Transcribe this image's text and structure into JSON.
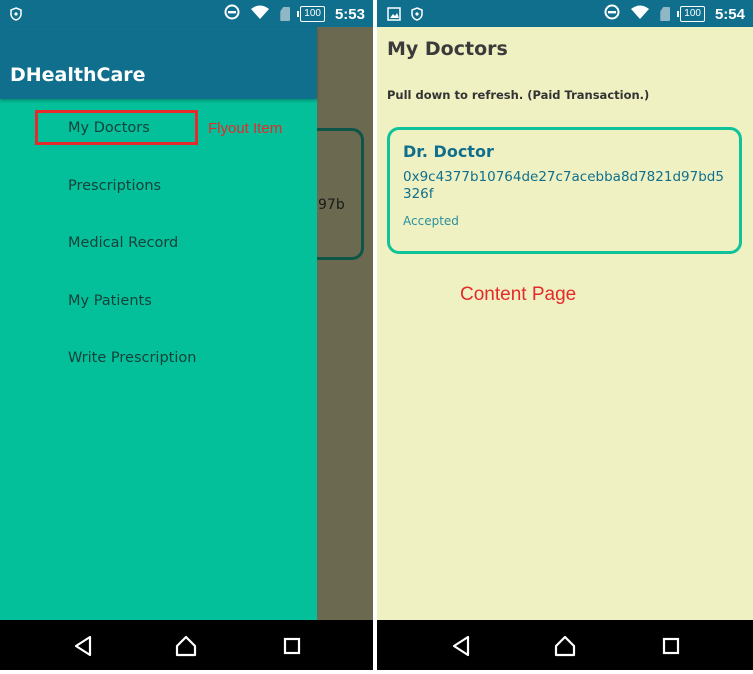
{
  "left_screen": {
    "status_bar": {
      "time": "5:53",
      "battery": "100"
    },
    "background_peek_text": "97b",
    "drawer": {
      "title": "DHealthCare",
      "items": [
        {
          "label": "My Doctors"
        },
        {
          "label": "Prescriptions"
        },
        {
          "label": "Medical Record"
        },
        {
          "label": "My Patients"
        },
        {
          "label": "Write Prescription"
        }
      ]
    },
    "annotation": "Flyout Item"
  },
  "right_screen": {
    "status_bar": {
      "time": "5:54",
      "battery": "100"
    },
    "page_title": "My Doctors",
    "refresh_hint": "Pull down to refresh. (Paid Transaction.)",
    "doctor_card": {
      "name": "Dr. Doctor",
      "address": "0x9c4377b10764de27c7acebba8d7821d97bd5326f",
      "status": "Accepted"
    },
    "annotation": "Content Page"
  },
  "colors": {
    "header": "#0f6f8d",
    "drawer": "#04c09a",
    "page_bg": "#f0f1c2",
    "annotation": "#e32b2b",
    "card_border": "#10c29a"
  },
  "icons": {
    "status_left": [
      "shield-icon",
      "image-icon"
    ],
    "status_right": [
      "dnd-icon",
      "wifi-icon",
      "sim-icon",
      "battery-icon"
    ],
    "nav": [
      "back-icon",
      "home-icon",
      "recents-icon"
    ]
  }
}
